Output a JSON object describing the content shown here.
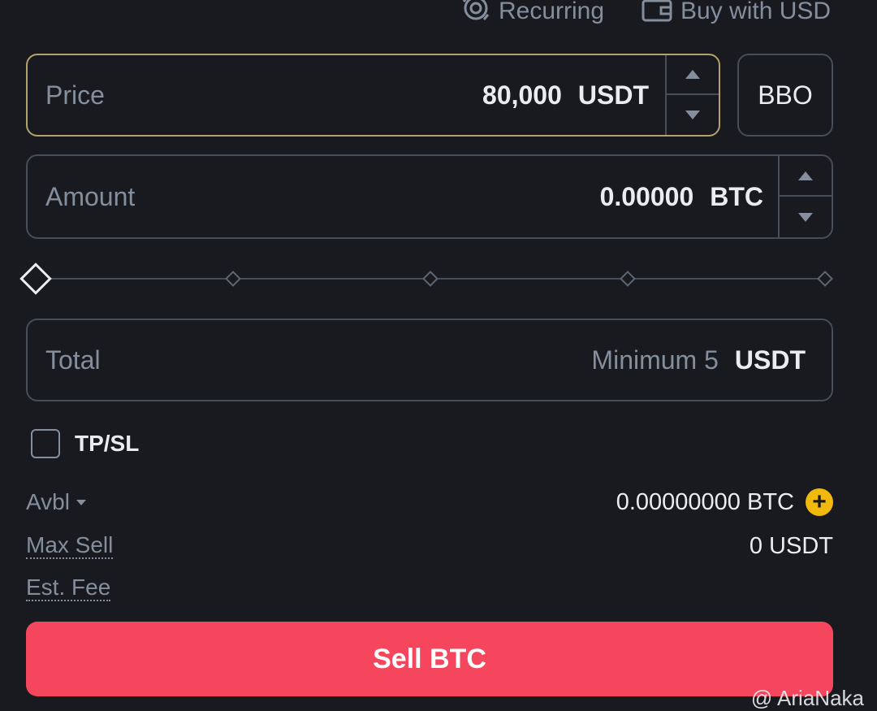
{
  "top_links": {
    "recurring": {
      "label": "Recurring",
      "icon": "recurring-icon"
    },
    "buy_with": {
      "label": "Buy with USD",
      "icon": "wallet-icon"
    }
  },
  "price": {
    "label": "Price",
    "value": "80,000",
    "unit": "USDT"
  },
  "bbo": {
    "label": "BBO"
  },
  "amount": {
    "label": "Amount",
    "value": "0.00000",
    "unit": "BTC"
  },
  "slider": {
    "value_percent": 0,
    "marks_percent": [
      0,
      25,
      50,
      75,
      100
    ]
  },
  "total": {
    "label": "Total",
    "placeholder": "Minimum 5",
    "unit": "USDT"
  },
  "tpsl": {
    "label": "TP/SL",
    "checked": false
  },
  "avbl": {
    "label": "Avbl",
    "value": "0.00000000 BTC"
  },
  "max_sell": {
    "label": "Max Sell",
    "value": "0 USDT"
  },
  "est_fee": {
    "label": "Est. Fee"
  },
  "sell_button": {
    "label": "Sell BTC"
  },
  "watermark": {
    "text": "@ AriaNaka"
  },
  "colors": {
    "sell": "#f6465d",
    "accent": "#f0b90b",
    "background": "#181a20"
  }
}
